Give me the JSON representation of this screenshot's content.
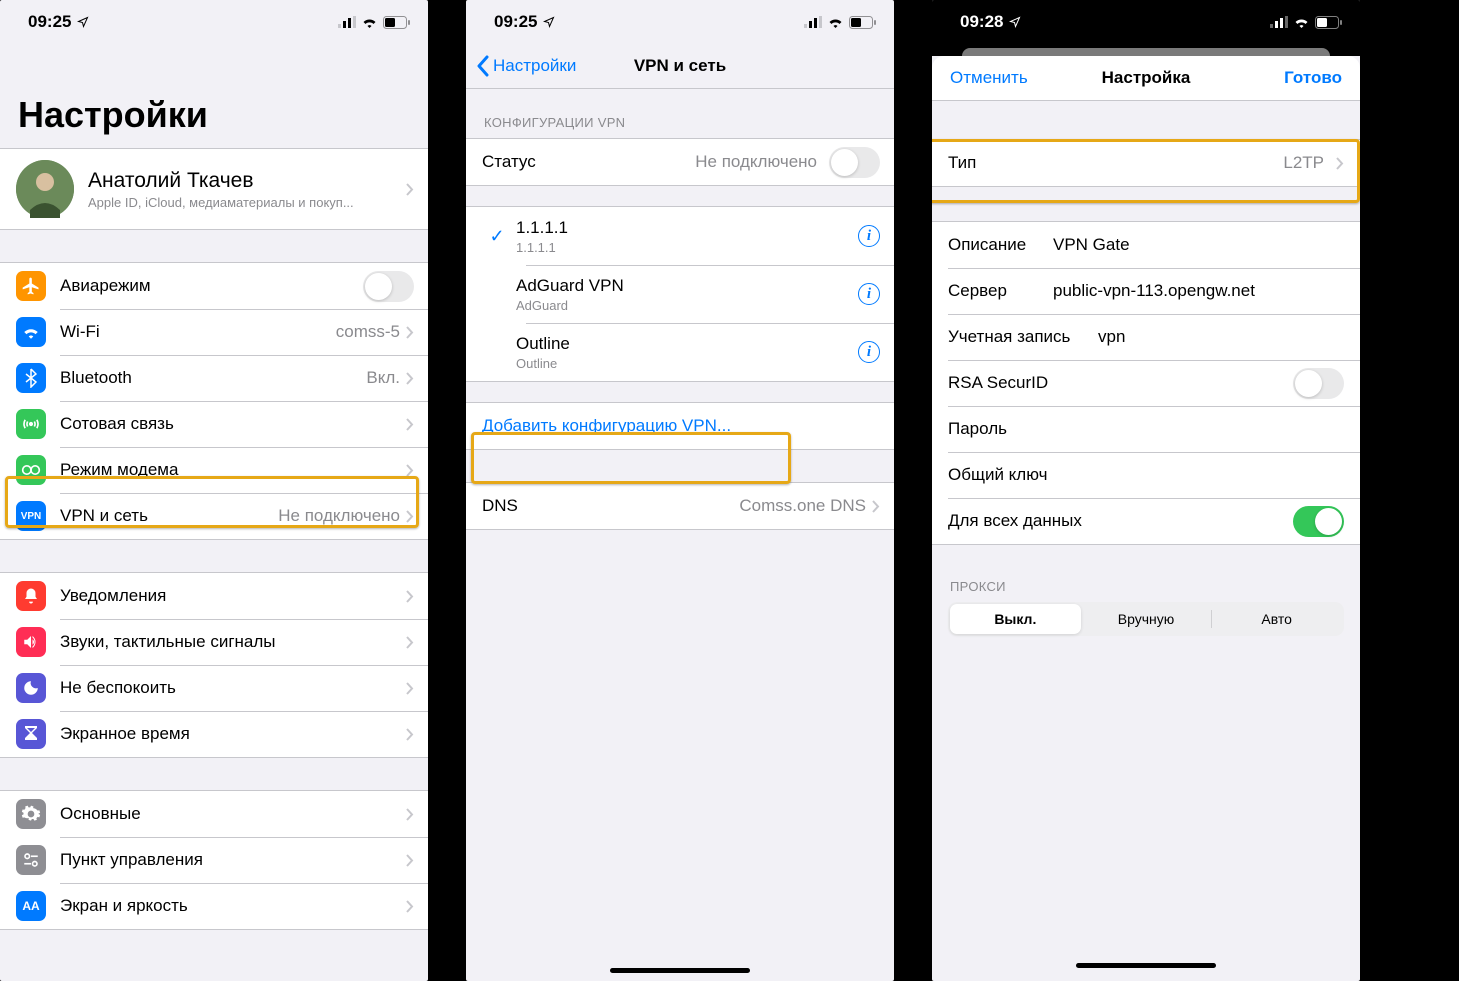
{
  "status": {
    "time1": "09:25",
    "time2": "09:25",
    "time3": "09:28"
  },
  "s1": {
    "title": "Настройки",
    "profile_name": "Анатолий Ткачев",
    "profile_sub": "Apple ID, iCloud, медиаматериалы и покуп...",
    "airplane": "Авиарежим",
    "wifi": "Wi-Fi",
    "wifi_val": "comss-5",
    "bluetooth": "Bluetooth",
    "bluetooth_val": "Вкл.",
    "cellular": "Сотовая связь",
    "hotspot": "Режим модема",
    "vpn": "VPN и сеть",
    "vpn_val": "Не подключено",
    "notifications": "Уведомления",
    "sounds": "Звуки, тактильные сигналы",
    "dnd": "Не беспокоить",
    "screentime": "Экранное время",
    "general": "Основные",
    "control": "Пункт управления",
    "display": "Экран и яркость"
  },
  "s2": {
    "back": "Настройки",
    "title": "VPN и сеть",
    "section": "КОНФИГУРАЦИИ VPN",
    "status_label": "Статус",
    "status_val": "Не подключено",
    "vpn1_title": "1.1.1.1",
    "vpn1_sub": "1.1.1.1",
    "vpn2_title": "AdGuard VPN",
    "vpn2_sub": "AdGuard",
    "vpn3_title": "Outline",
    "vpn3_sub": "Outline",
    "add": "Добавить конфигурацию VPN...",
    "dns_label": "DNS",
    "dns_val": "Comss.one DNS"
  },
  "s3": {
    "cancel": "Отменить",
    "title": "Настройка",
    "done": "Готово",
    "type_label": "Тип",
    "type_val": "L2TP",
    "desc_label": "Описание",
    "desc_val": "VPN Gate",
    "server_label": "Сервер",
    "server_val": "public-vpn-113.opengw.net",
    "account_label": "Учетная запись",
    "account_val": "vpn",
    "rsa_label": "RSA SecurID",
    "password_label": "Пароль",
    "secret_label": "Общий ключ",
    "alldata_label": "Для всех данных",
    "proxy_section": "ПРОКСИ",
    "seg_off": "Выкл.",
    "seg_manual": "Вручную",
    "seg_auto": "Авто"
  }
}
